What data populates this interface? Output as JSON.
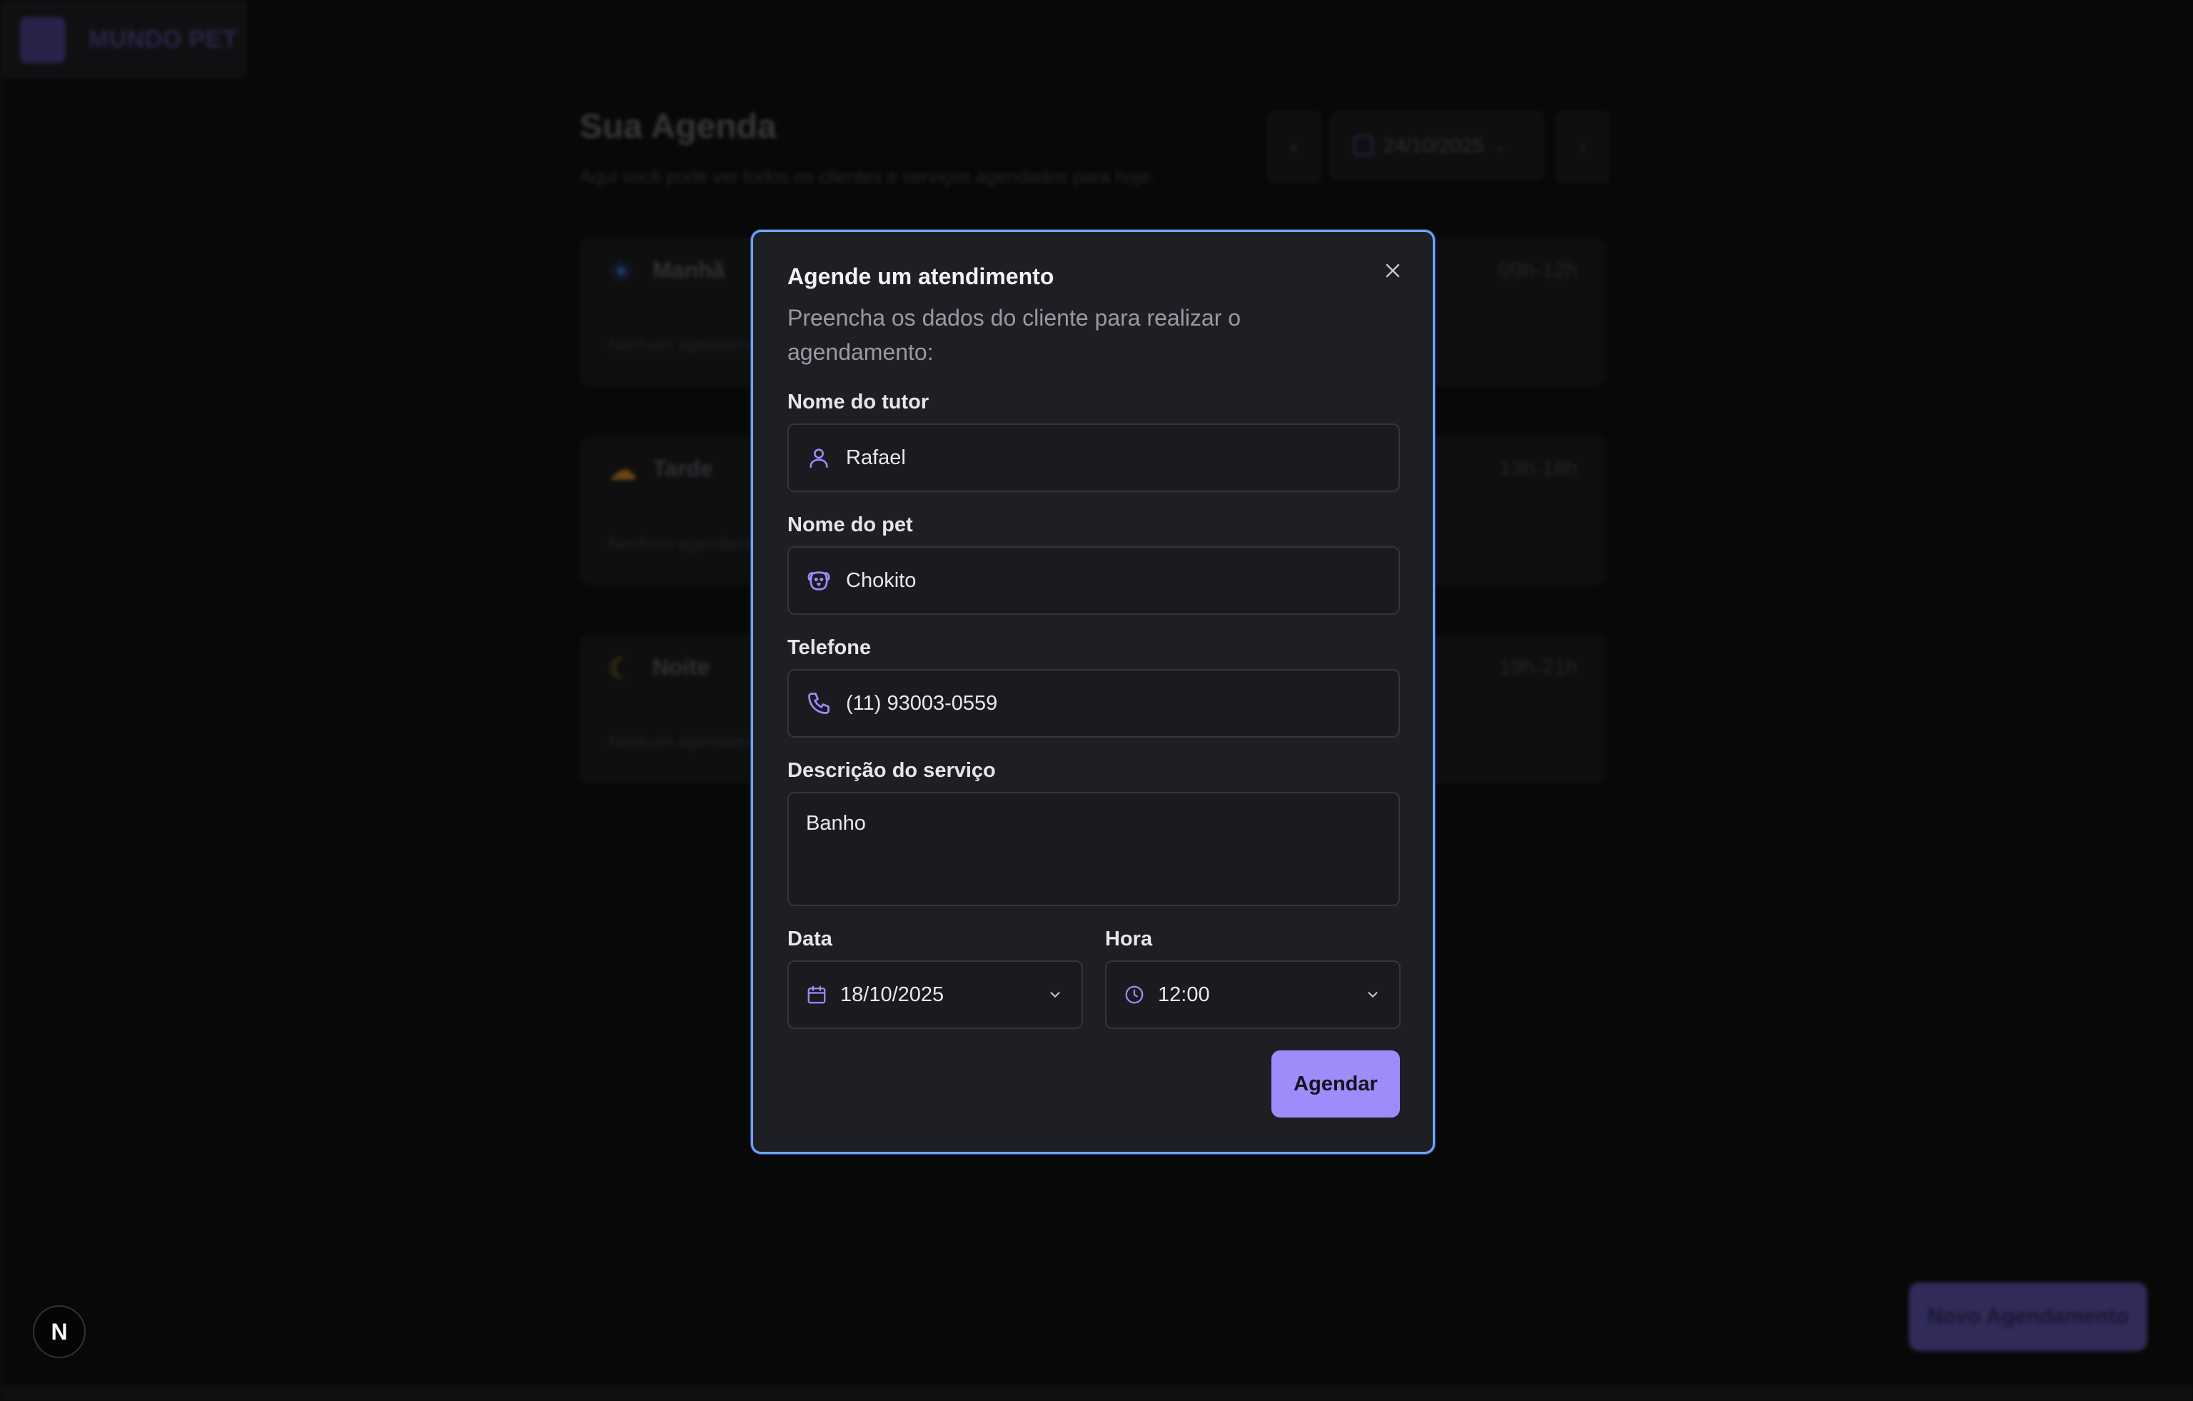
{
  "brand": {
    "name": "MUNDO PET"
  },
  "agenda": {
    "title": "Sua Agenda",
    "subtitle": "Aqui você pode ver todos os clientes e serviços agendados para hoje.",
    "date": "24/10/2025",
    "periods": [
      {
        "name": "Manhã",
        "range": "09h-12h",
        "empty": "Nenhum agendamento",
        "icon": "sun-icon",
        "color": "#2d5aa8"
      },
      {
        "name": "Tarde",
        "range": "13h-18h",
        "empty": "Nenhum agendamento",
        "icon": "cloud-sun-icon",
        "color": "#a86a1c"
      },
      {
        "name": "Noite",
        "range": "19h-21h",
        "empty": "Nenhum agendamento",
        "icon": "moon-icon",
        "color": "#8a7a1a"
      }
    ],
    "new_button": "Novo Agendamento"
  },
  "modal": {
    "title": "Agende um atendimento",
    "description": "Preencha os dados do cliente para realizar o agendamento:",
    "fields": {
      "tutor": {
        "label": "Nome do tutor",
        "value": "Rafael",
        "icon": "user-icon"
      },
      "pet": {
        "label": "Nome do pet",
        "value": "Chokito",
        "icon": "dog-icon"
      },
      "phone": {
        "label": "Telefone",
        "value": "(11) 93003-0559",
        "icon": "phone-icon"
      },
      "service": {
        "label": "Descrição do serviço",
        "value": "Banho"
      },
      "date": {
        "label": "Data",
        "value": "18/10/2025",
        "icon": "calendar-icon"
      },
      "time": {
        "label": "Hora",
        "value": "12:00",
        "icon": "clock-icon"
      }
    },
    "submit": "Agendar"
  },
  "dev_badge": "N",
  "colors": {
    "accent": "#9d8dfa",
    "modal_border": "#6aa6ff"
  }
}
